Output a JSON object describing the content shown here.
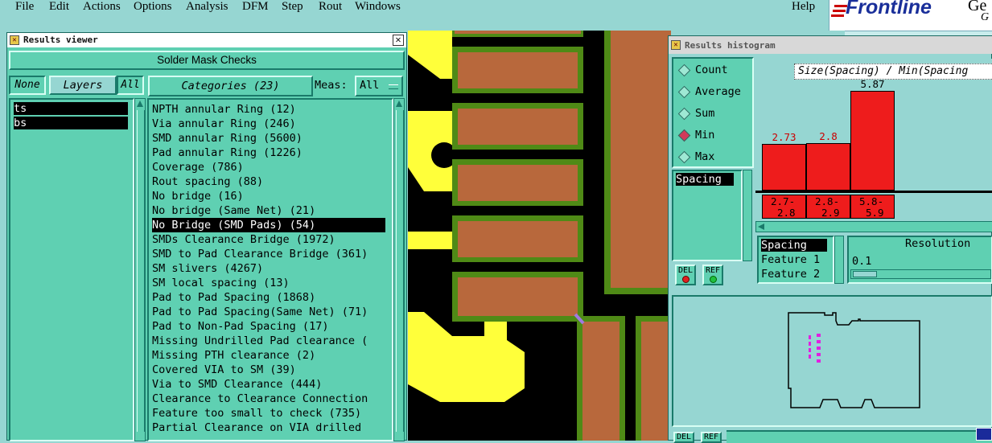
{
  "menu": [
    "File",
    "Edit",
    "Actions",
    "Options",
    "Analysis",
    "DFM",
    "Step",
    "Rout",
    "Windows"
  ],
  "help": "Help",
  "logo": {
    "brand": "Frontline",
    "fragment1": "Ge",
    "fragment2": "G"
  },
  "results_viewer": {
    "title": "Results viewer",
    "header": "Solder Mask Checks",
    "none_btn": "None",
    "layers_btn": "Layers",
    "all_btn": "All",
    "categories_btn": "Categories (23)",
    "meas_label": "Meas:",
    "meas_value": "All",
    "layers": [
      "ts",
      "bs"
    ],
    "categories": [
      "NPTH annular Ring (12)",
      "Via annular Ring (246)",
      "SMD annular Ring (5600)",
      "Pad annular Ring (1226)",
      "Coverage (786)",
      "Rout spacing (88)",
      "No bridge (16)",
      "No bridge (Same Net) (21)",
      "No Bridge (SMD Pads) (54)",
      "SMDs Clearance Bridge (1972)",
      "SMD to Pad Clearance Bridge (361)",
      "SM slivers (4267)",
      "SM local spacing (13)",
      "Pad to Pad Spacing (1868)",
      "Pad to Pad Spacing(Same Net) (71)",
      "Pad to Non-Pad Spacing (17)",
      "Missing Undrilled Pad clearance (",
      "Missing PTH clearance (2)",
      "Covered VIA to SM (39)",
      "Via to SMD Clearance (444)",
      "Clearance to Clearance Connection",
      "Feature too small to check (735)",
      "Partial Clearance on VIA drilled"
    ],
    "selected_index": 8
  },
  "histogram": {
    "title": "Results histogram",
    "modes": [
      "Count",
      "Average",
      "Sum",
      "Min",
      "Max"
    ],
    "selected_mode": "Min",
    "list_items": [
      "Spacing"
    ],
    "chart_title": "Size(Spacing) / Min(Spacing",
    "bars": [
      {
        "value": "2.73",
        "range1": "2.7-",
        "range2": "2.8"
      },
      {
        "value": "2.8",
        "range1": "2.8-",
        "range2": "2.9"
      },
      {
        "value": "5.87",
        "range1": "5.8-",
        "range2": "5.9"
      }
    ],
    "bar_values": [
      2.73,
      2.8,
      5.87
    ],
    "del_btn": "DEL",
    "ref_btn": "REF",
    "fields": [
      "Spacing",
      "Feature 1",
      "Feature 2"
    ],
    "resolution_label": "Resolution",
    "resolution_value": "0.1"
  },
  "bottom_buttons": [
    "DEL",
    "REF"
  ],
  "colors": {
    "panel": "#5fd0b2",
    "bg": "#96d6d2",
    "copper": "#b8683c",
    "mask": "#4f8a16",
    "pad": "#ffff3a",
    "bar": "#ee1c1c"
  }
}
